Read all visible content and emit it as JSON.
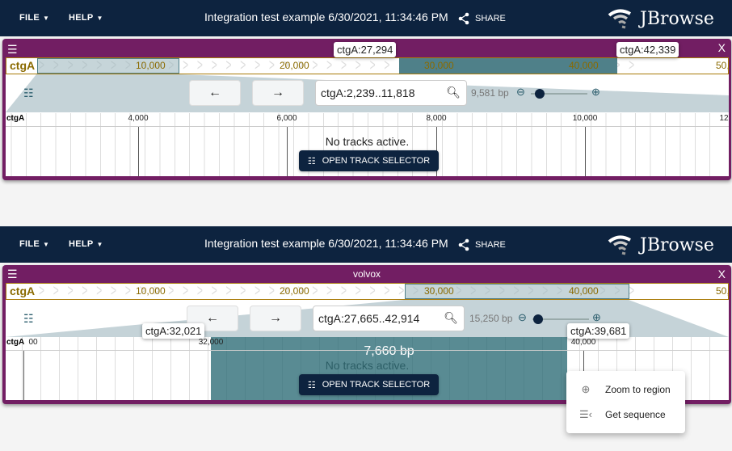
{
  "header": {
    "file_menu": "FILE",
    "help_menu": "HELP",
    "title": "Integration test example 6/30/2021, 11:34:46 PM",
    "share": "SHARE",
    "logo": "JBrowse"
  },
  "colors": {
    "header_bg": "#0d233f",
    "view_border": "#721e63",
    "overview_highlight": "#4f8089",
    "ruler_label": "#8a6a00"
  },
  "overview_ticks": [
    "10,000",
    "20,000",
    "30,000",
    "40,000",
    "50,"
  ],
  "common": {
    "open_track_selector": "OPEN TRACK SELECTOR",
    "no_tracks": "No tracks active.",
    "back": "←",
    "forward": "→"
  },
  "view1": {
    "title": "",
    "refname": "ctgA",
    "location": "ctgA:2,239..11,818",
    "bp_width": "9,581 bp",
    "zoom_level": 0.15,
    "ruler_ticks": [
      "4,000",
      "6,000",
      "8,000",
      "10,000",
      "12"
    ],
    "tooltips": [
      "ctgA:27,294",
      "ctgA:42,339"
    ]
  },
  "view2": {
    "title": "volvox",
    "refname": "ctgA",
    "location": "ctgA:27,665..42,914",
    "bp_width": "15,250 bp",
    "zoom_level": 0.1,
    "ruler_ticks": [
      "00",
      "32,000",
      "40,000"
    ],
    "rubberband_width": "7,660 bp",
    "tooltips": [
      "ctgA:32,021",
      "ctgA:39,681"
    ],
    "context_menu": [
      {
        "label": "Zoom to region",
        "icon": "zoom-in-icon"
      },
      {
        "label": "Get sequence",
        "icon": "sequence-icon"
      }
    ]
  }
}
